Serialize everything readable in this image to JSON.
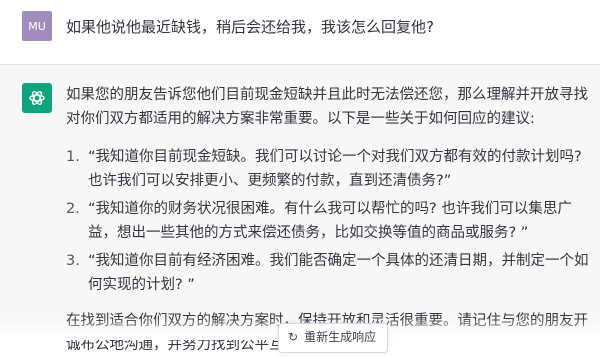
{
  "user_message": {
    "avatar_text": "MU",
    "text": "如果他说他最近缺钱，稍后会还给我，我该怎么回复他?"
  },
  "assistant_message": {
    "intro": "如果您的朋友告诉您他们目前现金短缺并且此时无法偿还您，那么理解并开放寻找对你们双方都适用的解决方案非常重要。以下是一些关于如何回应的建议:",
    "suggestions": [
      {
        "number": "1.",
        "text": "“我知道你目前现金短缺。我们可以讨论一个对我们双方都有效的付款计划吗? 也许我们可以安排更小、更频繁的付款，直到还清债务?”"
      },
      {
        "number": "2.",
        "text": "“我知道你的财务状况很困难。有什么我可以帮忙的吗? 也许我们可以集思广益，想出一些其他的方式来偿还债务，比如交换等值的商品或服务? ”"
      },
      {
        "number": "3.",
        "text": "“我知道你目前有经济困难。我们能否确定一个具体的还清日期，并制定一个如何实现的计划? ”"
      }
    ],
    "conclusion": "在找到适合你们双方的解决方案时，保持开放和灵活很重要。请记住与您的朋友开诚布公地沟通，并努力找到公平互利的解决方案"
  },
  "regenerate_button": {
    "label": "重新生成响应",
    "icon": "refresh-icon"
  },
  "colors": {
    "user_avatar": "#a18cbd",
    "assistant_avatar": "#10a37f",
    "assistant_background": "#f7f7f8"
  }
}
